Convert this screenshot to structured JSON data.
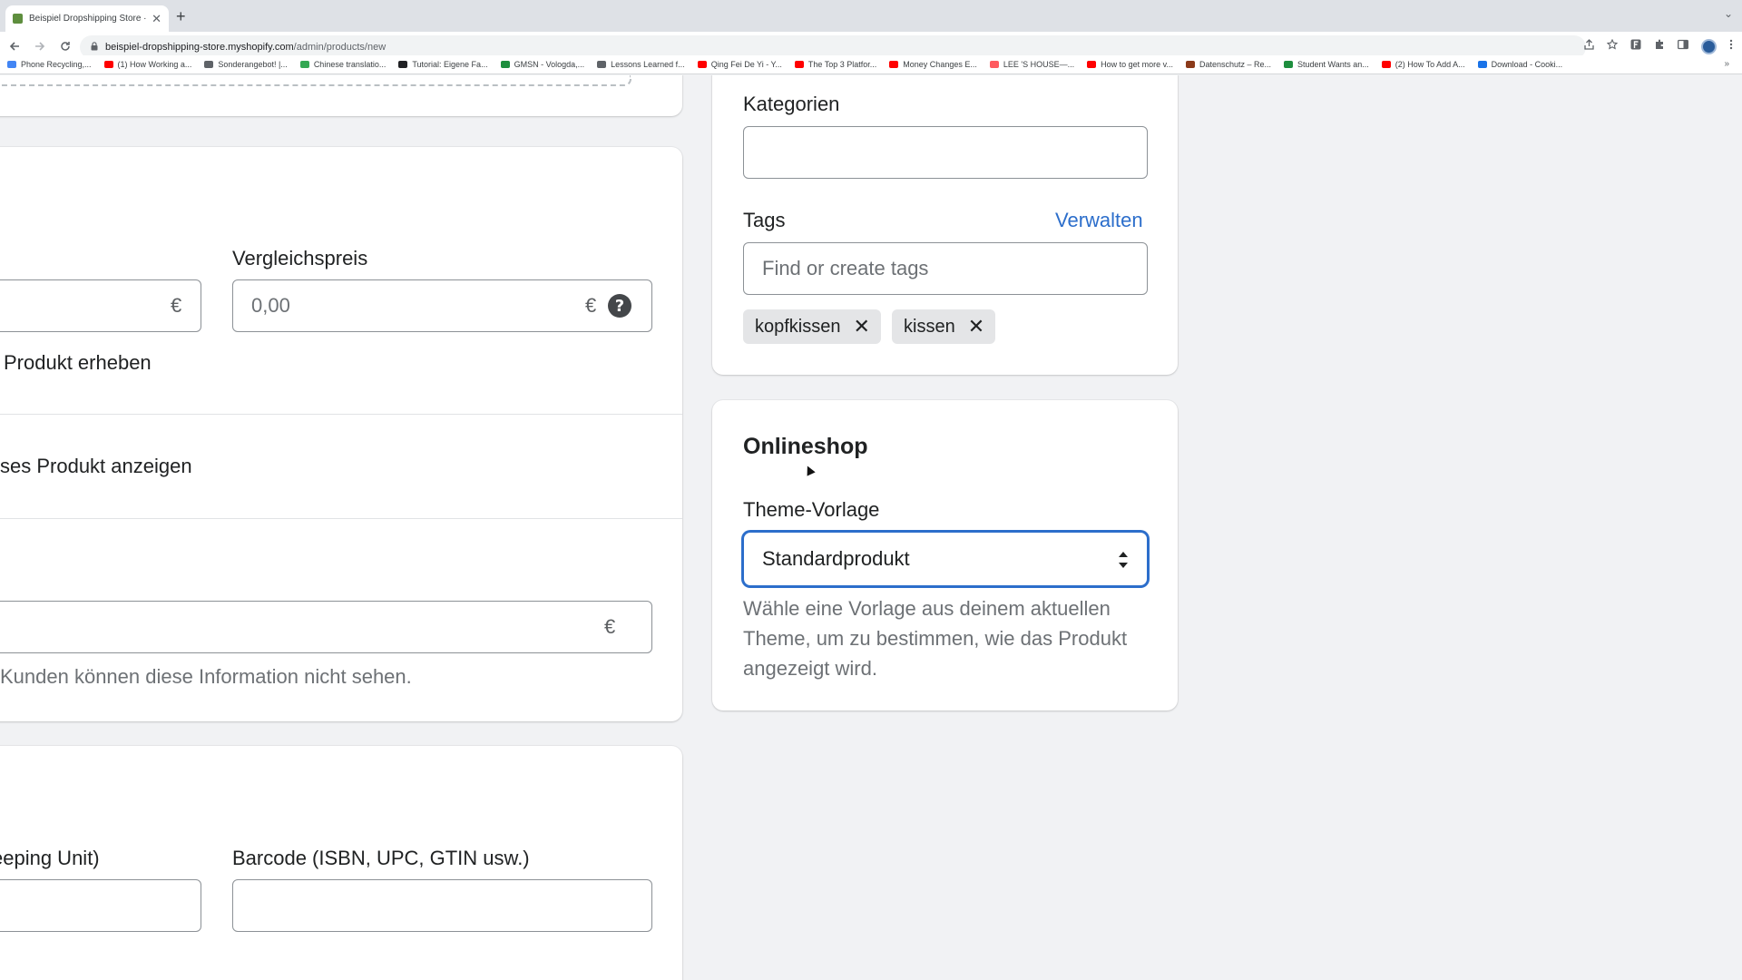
{
  "browser": {
    "tab_title": "Beispiel Dropshipping Store · F",
    "tab_close": "✕",
    "new_tab": "+",
    "tab_menu": "⌄",
    "url_host": "beispiel-dropshipping-store.myshopify.com",
    "url_path": "/admin/products/new",
    "bookmarks": [
      {
        "label": "Phone Recycling,...",
        "color": "#4285f4"
      },
      {
        "label": "(1) How Working a...",
        "color": "#ff0000"
      },
      {
        "label": "Sonderangebot! |...",
        "color": "#5f6368"
      },
      {
        "label": "Chinese translatio...",
        "color": "#34a853"
      },
      {
        "label": "Tutorial: Eigene Fa...",
        "color": "#202124"
      },
      {
        "label": "GMSN - Vologda,...",
        "color": "#1e8e3e"
      },
      {
        "label": "Lessons Learned f...",
        "color": "#5f6368"
      },
      {
        "label": "Qing Fei De Yi - Y...",
        "color": "#ff0000"
      },
      {
        "label": "The Top 3 Platfor...",
        "color": "#ff0000"
      },
      {
        "label": "Money Changes E...",
        "color": "#ff0000"
      },
      {
        "label": "LEE 'S HOUSE—...",
        "color": "#ff5a5f"
      },
      {
        "label": "How to get more v...",
        "color": "#ff0000"
      },
      {
        "label": "Datenschutz – Re...",
        "color": "#8b3a1a"
      },
      {
        "label": "Student Wants an...",
        "color": "#1e8e3e"
      },
      {
        "label": "(2) How To Add A...",
        "color": "#ff0000"
      },
      {
        "label": "Download - Cooki...",
        "color": "#1a73e8"
      }
    ],
    "bookmarks_more": "»"
  },
  "pricing": {
    "price_suffix": "€",
    "compare_label": "Vergleichspreis",
    "compare_placeholder": "0,00",
    "compare_suffix": "€",
    "help_icon": "?",
    "tax_label": "Produkt erheben",
    "unit_price_label": "ses Produkt anzeigen",
    "cost_suffix": "€",
    "cost_help": "Kunden können diese Information nicht sehen."
  },
  "inventory": {
    "sku_label": "eeping Unit)",
    "barcode_label": "Barcode (ISBN, UPC, GTIN usw.)"
  },
  "organization": {
    "categories_label": "Kategorien",
    "tags_label": "Tags",
    "manage_link": "Verwalten",
    "tags_placeholder": "Find or create tags",
    "tags": [
      "kopfkissen",
      "kissen"
    ],
    "remove_icon": "✕"
  },
  "online_store": {
    "heading": "Onlineshop",
    "template_label": "Theme-Vorlage",
    "template_value": "Standardprodukt",
    "template_help": "Wähle eine Vorlage aus deinem aktuellen Theme, um zu bestimmen, wie das Produkt angezeigt wird."
  }
}
